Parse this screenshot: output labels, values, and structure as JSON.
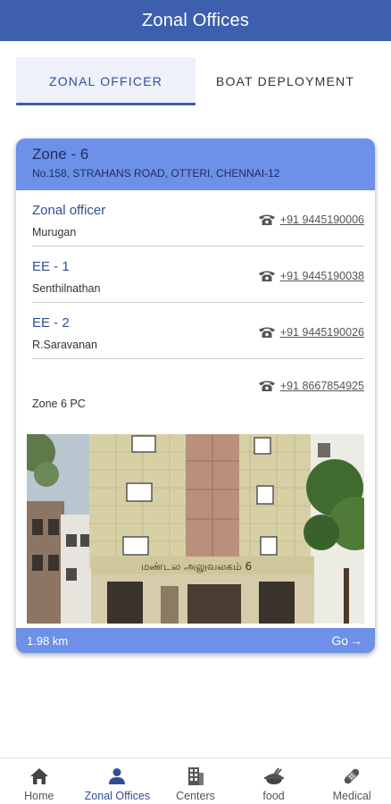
{
  "app_bar": {
    "title": "Zonal Offices"
  },
  "tabs": [
    {
      "label": "ZONAL OFFICER",
      "active": true
    },
    {
      "label": "BOAT DEPLOYMENT",
      "active": false
    }
  ],
  "zone_card": {
    "zone_name": "Zone - 6",
    "address": "No.158, STRAHANS ROAD, OTTERI, CHENNAI-12",
    "contacts": [
      {
        "role": "Zonal officer",
        "name": "Murugan",
        "phone": "+91 9445190006"
      },
      {
        "role": "EE - 1",
        "name": "Senthilnathan",
        "phone": "+91 9445190038"
      },
      {
        "role": "EE - 2",
        "name": "R.Saravanan",
        "phone": "+91 9445190026"
      },
      {
        "role": "",
        "name": "Zone 6 PC",
        "phone": "+91 8667854925"
      }
    ],
    "image": {
      "building_sign": "மண்டல அலுவலகம் 6"
    },
    "distance": "1.98 km",
    "go_label": "Go"
  },
  "bottom_nav": [
    {
      "label": "Home",
      "icon": "home-icon",
      "active": false
    },
    {
      "label": "Zonal Offices",
      "icon": "person-icon",
      "active": true
    },
    {
      "label": "Centers",
      "icon": "building-icon",
      "active": false
    },
    {
      "label": "food",
      "icon": "food-icon",
      "active": false
    },
    {
      "label": "Medical",
      "icon": "bandage-icon",
      "active": false
    }
  ],
  "colors": {
    "app_bar": "#3d5fae",
    "card_accent": "#6d90e8",
    "primary_text": "#2f4f95"
  }
}
